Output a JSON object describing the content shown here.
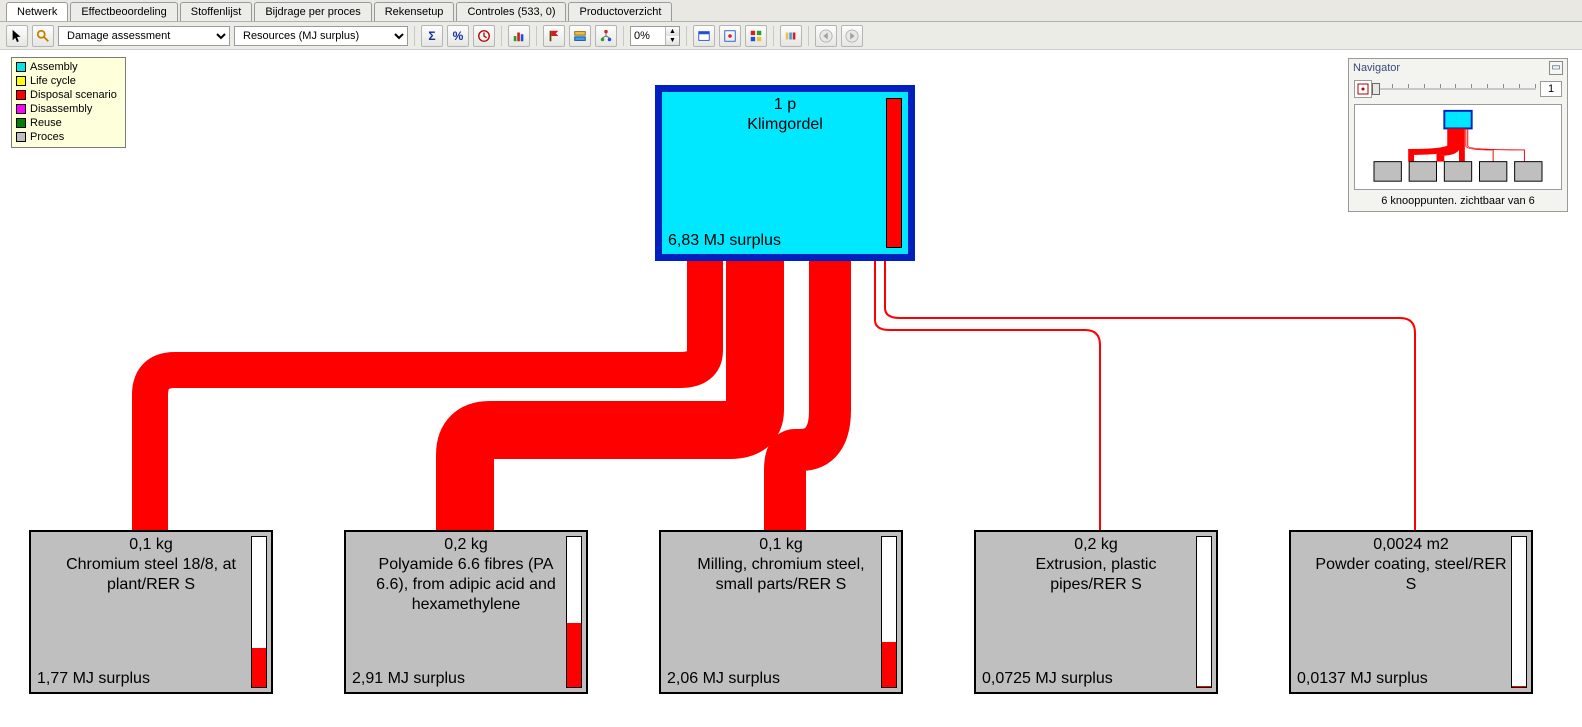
{
  "tabs": [
    {
      "label": "Netwerk",
      "active": true
    },
    {
      "label": "Effectbeoordeling",
      "active": false
    },
    {
      "label": "Stoffenlijst",
      "active": false
    },
    {
      "label": "Bijdrage per proces",
      "active": false
    },
    {
      "label": "Rekensetup",
      "active": false
    },
    {
      "label": "Controles (533, 0)",
      "active": false
    },
    {
      "label": "Productoverzicht",
      "active": false
    }
  ],
  "toolbar": {
    "combo1": "Damage assessment",
    "combo2": "Resources (MJ surplus)",
    "spin": "0%"
  },
  "legend": [
    {
      "label": "Assembly",
      "color": "#00e5e5"
    },
    {
      "label": "Life cycle",
      "color": "#ffff00"
    },
    {
      "label": "Disposal scenario",
      "color": "#ff0000"
    },
    {
      "label": "Disassembly",
      "color": "#ff00ff"
    },
    {
      "label": "Reuse",
      "color": "#008000"
    },
    {
      "label": "Proces",
      "color": "#bfbfbf"
    }
  ],
  "navigator": {
    "title": "Navigator",
    "value": "1",
    "caption": "6 knooppunten. zichtbaar van 6"
  },
  "chart_data": {
    "type": "diagram",
    "unit": "MJ surplus",
    "root": {
      "id": "klimgordel",
      "kind": "assembly",
      "qty": "1 p",
      "name": "Klimgordel",
      "value": "6,83 MJ surplus",
      "value_num": 6.83,
      "bar_fill": 1.0
    },
    "children": [
      {
        "id": "chromium",
        "kind": "proces",
        "qty": "0,1 kg",
        "name": "Chromium steel 18/8, at plant/RER S",
        "value": "1,77 MJ surplus",
        "value_num": 1.77,
        "bar_fill": 0.26
      },
      {
        "id": "polyamide",
        "kind": "proces",
        "qty": "0,2 kg",
        "name": "Polyamide 6.6 fibres (PA 6.6), from adipic acid and hexamethylene",
        "value": "2,91 MJ surplus",
        "value_num": 2.91,
        "bar_fill": 0.43
      },
      {
        "id": "milling",
        "kind": "proces",
        "qty": "0,1 kg",
        "name": "Milling, chromium steel, small parts/RER S",
        "value": "2,06 MJ surplus",
        "value_num": 2.06,
        "bar_fill": 0.3
      },
      {
        "id": "extrusion",
        "kind": "proces",
        "qty": "0,2 kg",
        "name": "Extrusion, plastic pipes/RER S",
        "value": "0,0725 MJ surplus",
        "value_num": 0.0725,
        "bar_fill": 0.01
      },
      {
        "id": "powder",
        "kind": "proces",
        "qty": "0,0024 m2",
        "name": "Powder coating, steel/RER S",
        "value": "0,0137 MJ surplus",
        "value_num": 0.0137,
        "bar_fill": 0.002
      }
    ],
    "flows": [
      {
        "from": "chromium",
        "to": "klimgordel",
        "weight": 1.77
      },
      {
        "from": "polyamide",
        "to": "klimgordel",
        "weight": 2.91
      },
      {
        "from": "milling",
        "to": "klimgordel",
        "weight": 2.06
      },
      {
        "from": "extrusion",
        "to": "klimgordel",
        "weight": 0.0725
      },
      {
        "from": "powder",
        "to": "klimgordel",
        "weight": 0.0137
      }
    ]
  }
}
